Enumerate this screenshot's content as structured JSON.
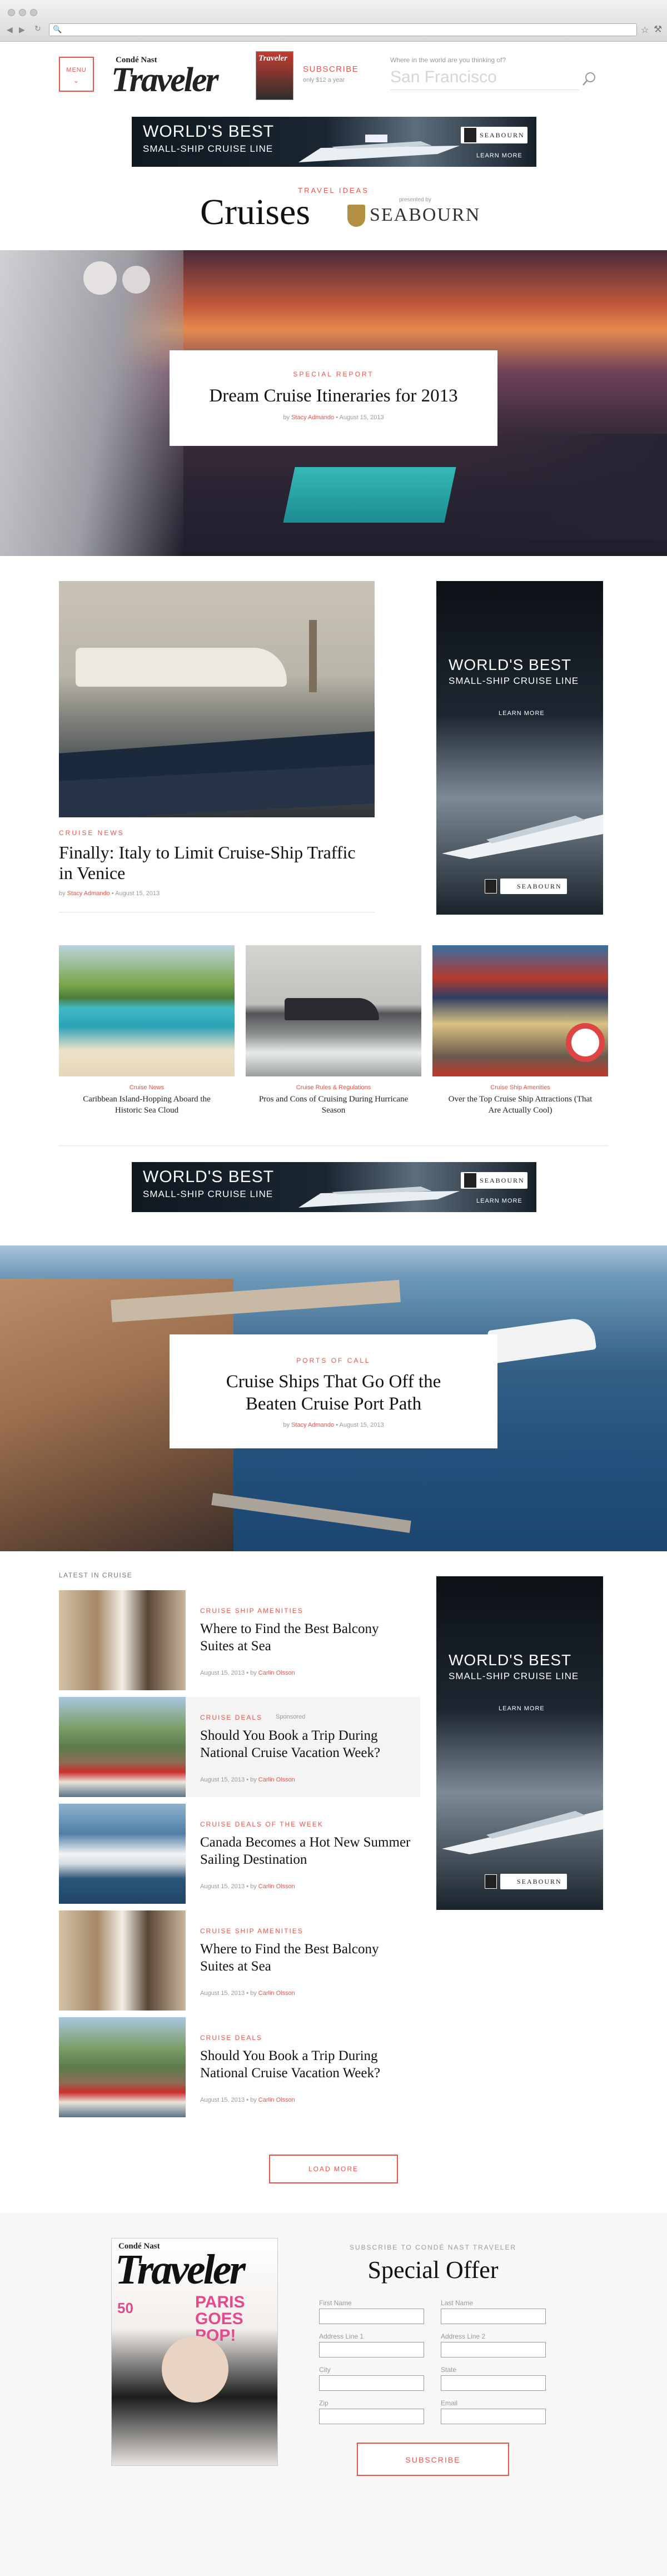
{
  "browser": {
    "back_icon": "back-arrow-icon",
    "forward_icon": "forward-arrow-icon",
    "refresh_icon": "refresh-icon"
  },
  "header": {
    "menu_label": "MENU",
    "brand_small": "Condé Nast",
    "brand_big": "Traveler",
    "subscribe_title": "SUBSCRIBE",
    "subscribe_sub": "only $12 a year",
    "search_prompt": "Where in the world are you thinking of?",
    "search_placeholder": "San Francisco"
  },
  "ad": {
    "line1": "WORLD'S BEST",
    "line2": "SMALL-SHIP CRUISE LINE",
    "brand": "SEABOURN",
    "cta": "LEARN MORE"
  },
  "section": {
    "eyebrow": "TRAVEL IDEAS",
    "title": "Cruises",
    "powered_by": "presented by",
    "sponsor": "SEABOURN"
  },
  "hero1": {
    "kicker": "SPECIAL REPORT",
    "title": "Dream Cruise Itineraries for 2013",
    "byline_prefix": "by",
    "author": "Stacy Admando",
    "date": "August 15, 2013"
  },
  "feature": {
    "kicker": "CRUISE NEWS",
    "title": "Finally: Italy to Limit Cruise-Ship Traffic in Venice",
    "byline_prefix": "by",
    "author": "Stacy Admando",
    "date": "August 15, 2013"
  },
  "trio": [
    {
      "kicker": "Cruise News",
      "title": "Caribbean Island-Hopping Aboard the Historic Sea Cloud"
    },
    {
      "kicker": "Cruise Rules & Regulations",
      "title": "Pros and Cons of Cruising During Hurricane Season"
    },
    {
      "kicker": "Cruise Ship Amenities",
      "title": "Over the Top Cruise Ship Attractions (That Are Actually Cool)"
    }
  ],
  "hero2": {
    "kicker": "PORTS OF CALL",
    "title": "Cruise Ships That Go Off the Beaten Cruise Port Path",
    "byline_prefix": "by",
    "author": "Stacy Admando",
    "date": "August 15, 2013"
  },
  "latest": {
    "heading": "LATEST IN CRUISE",
    "items": [
      {
        "kicker": "CRUISE SHIP AMENITIES",
        "title": "Where to Find the Best Balcony Suites at Sea",
        "date": "August 15, 2013",
        "by": "• by",
        "author": "Carlin Olsson",
        "sponsored": ""
      },
      {
        "kicker": "CRUISE DEALS",
        "title": "Should You Book a Trip During National Cruise Vacation Week?",
        "date": "August 15, 2013",
        "by": "• by",
        "author": "Carlin Olsson",
        "sponsored": "Sponsored"
      },
      {
        "kicker": "CRUISE DEALS OF THE WEEK",
        "title": "Canada Becomes a Hot New Summer Sailing Destination",
        "date": "August 15, 2013",
        "by": "• by",
        "author": "Carlin Olsson",
        "sponsored": ""
      },
      {
        "kicker": "CRUISE SHIP AMENITIES",
        "title": "Where to Find the Best Balcony Suites at Sea",
        "date": "August 15, 2013",
        "by": "• by",
        "author": "Carlin Olsson",
        "sponsored": ""
      },
      {
        "kicker": "CRUISE DEALS",
        "title": "Should You Book a Trip During National Cruise Vacation Week?",
        "date": "August 15, 2013",
        "by": "• by",
        "author": "Carlin Olsson",
        "sponsored": ""
      }
    ],
    "load_more": "LOAD MORE"
  },
  "offer": {
    "eyebrow": "SUBSCRIBE TO CONDÉ NAST TRAVELER",
    "title": "Special Offer",
    "cover_brand_small": "Condé Nast",
    "cover_brand_big": "Traveler",
    "cover_headline": "PARIS GOES POP!",
    "cover_num": "50",
    "fields": {
      "first": "First Name",
      "last": "Last Name",
      "addr1": "Address Line 1",
      "addr2": "Address Line 2",
      "city": "City",
      "state": "State",
      "zip": "Zip",
      "email": "Email"
    },
    "button": "SUBSCRIBE"
  }
}
